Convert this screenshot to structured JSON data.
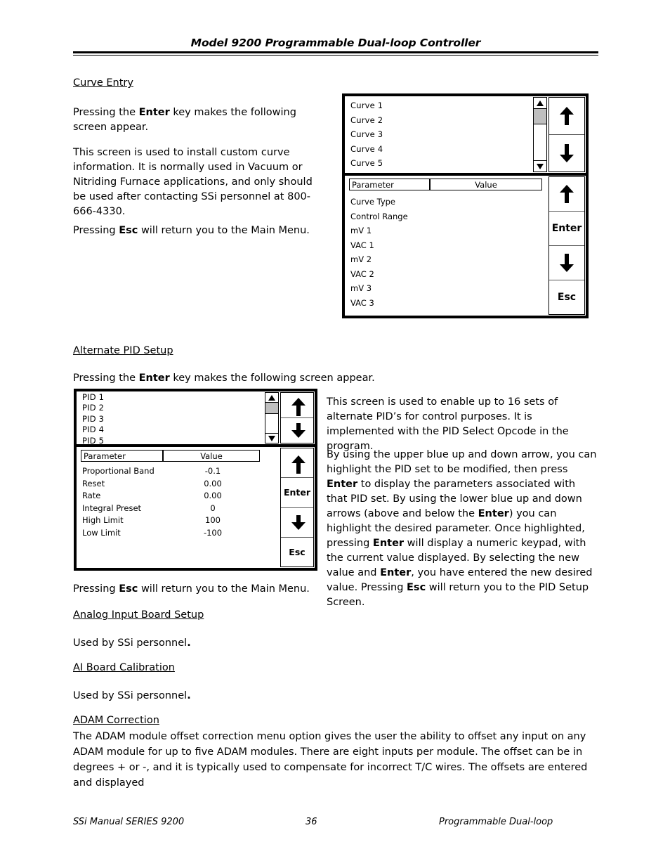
{
  "header": {
    "title": "Model 9200 Programmable Dual-loop Controller"
  },
  "footer": {
    "left": "SSi Manual SERIES 9200",
    "page": "36",
    "right": "Programmable Dual-loop"
  },
  "sections": {
    "curve_entry": {
      "heading": "Curve Entry",
      "p1_before": "Pressing the ",
      "p1_bold": "Enter",
      "p1_after": " key makes the following screen appear.",
      "p2": "This screen is used to install custom curve information. It is normally used in Vacuum or Nitriding Furnace applications, and only should be used after contacting SSi personnel at 800-666-4330.",
      "p3_before": "Pressing ",
      "p3_bold": "Esc",
      "p3_after": " will return you to the Main Menu."
    },
    "alternate_pid": {
      "heading": "Alternate PID Setup",
      "p1_before": "Pressing the ",
      "p1_bold": "Enter",
      "p1_after": " key makes the following screen appear.",
      "p_esc_before": "Pressing ",
      "p_esc_bold": "Esc",
      "p_esc_after": " will return you to the Main Menu."
    },
    "analog_input": {
      "heading": "Analog Input Board Setup",
      "body": "Used by SSi personnel",
      "body_bold": "."
    },
    "ai_calibration": {
      "heading": "AI Board Calibration",
      "body": "Used by SSi personnel",
      "body_bold": "."
    },
    "adam": {
      "heading": "ADAM Correction",
      "body": "The ADAM module offset correction menu option gives the user the ability to offset any input on any ADAM module for up to five ADAM modules.  There are eight inputs per module.  The offset can be in degrees + or -, and it is typically used to compensate for incorrect T/C wires.  The offsets are entered and displayed"
    }
  },
  "right_column": {
    "pid_p1_a": "This screen is used to enable up to 16 sets of alternate PID’s for control purposes. It is implemented with the PID Select Opcode in the program.",
    "pid_p2_a": "By using the upper blue up and down arrow, you can highlight the PID set to be modified, then press ",
    "pid_p2_b1": "Enter",
    "pid_p2_c": " to display the parameters associated with that PID set. By using the lower blue up and down arrows (above and below the ",
    "pid_p2_b2": "Enter",
    "pid_p2_d": ") you can highlight the desired parameter. Once highlighted, pressing ",
    "pid_p2_b3": "Enter",
    "pid_p2_e": " will display a numeric keypad, with the current value displayed. By selecting the new value and ",
    "pid_p2_b4": "Enter",
    "pid_p2_f": ", you have entered the new desired value. Pressing ",
    "pid_p2_b5": "Esc",
    "pid_p2_g": " will return you to the PID Setup Screen."
  },
  "curve_screen": {
    "list_items": [
      "Curve 1",
      "Curve 2",
      "Curve 3",
      "Curve 4",
      "Curve 5"
    ],
    "table_headers": {
      "name": "Parameter",
      "value": "Value"
    },
    "parameters": [
      {
        "name": "Curve Type",
        "value": ""
      },
      {
        "name": "Control Range",
        "value": ""
      },
      {
        "name": "mV 1",
        "value": ""
      },
      {
        "name": "VAC 1",
        "value": ""
      },
      {
        "name": "mV 2",
        "value": ""
      },
      {
        "name": "VAC 2",
        "value": ""
      },
      {
        "name": "mV 3",
        "value": ""
      },
      {
        "name": "VAC 3",
        "value": ""
      }
    ],
    "keys": {
      "enter": "Enter",
      "esc": "Esc"
    },
    "colors": {
      "thumb": "#bfbfbf",
      "border": "#000000",
      "background": "#ffffff"
    }
  },
  "pid_screen": {
    "list_items": [
      "PID 1",
      "PID 2",
      "PID 3",
      "PID 4",
      "PID 5"
    ],
    "table_headers": {
      "name": "Parameter",
      "value": "Value"
    },
    "parameters": [
      {
        "name": "Proportional Band",
        "value": "-0.1"
      },
      {
        "name": "Reset",
        "value": "0.00"
      },
      {
        "name": "Rate",
        "value": "0.00"
      },
      {
        "name": "Integral Preset",
        "value": "0"
      },
      {
        "name": "High Limit",
        "value": "100"
      },
      {
        "name": "Low Limit",
        "value": "-100"
      }
    ],
    "keys": {
      "enter": "Enter",
      "esc": "Esc"
    },
    "colors": {
      "thumb": "#bfbfbf",
      "border": "#000000",
      "background": "#ffffff"
    }
  }
}
